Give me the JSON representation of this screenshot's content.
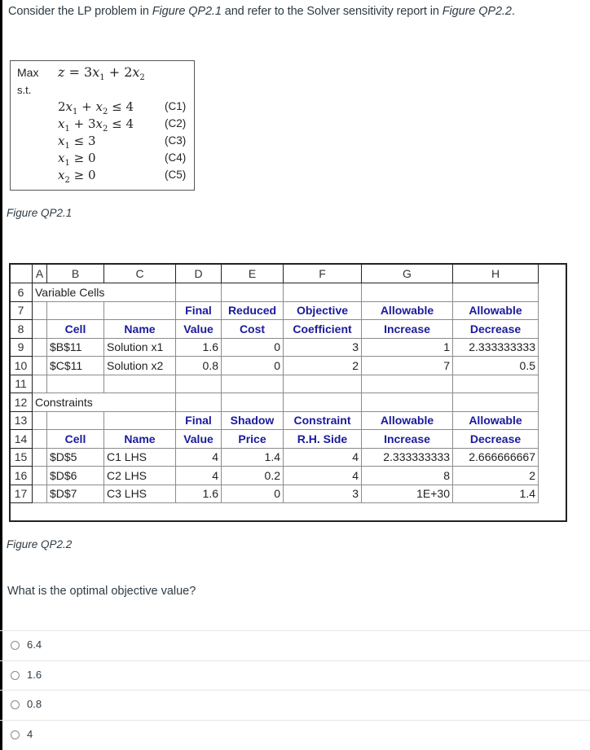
{
  "intro": {
    "prefix": "Consider the LP problem in ",
    "fig1_ref": "Figure QP2.1",
    "middle": " and refer to the Solver sensitivity report in ",
    "fig2_ref": "Figure QP2.2",
    "suffix": "."
  },
  "lp_model": {
    "max_label": "Max",
    "st_label": "s.t.",
    "objective": {
      "lhs": "z",
      "eq": " = 3",
      "v1": "x",
      "s1": "1",
      "plus": " + 2",
      "v2": "x",
      "s2": "2"
    },
    "constraints": [
      {
        "expr_html": "2<i>x</i><sub>1</sub> + <i>x</i><sub>2</sub> ≤ 4",
        "tag": "(C1)"
      },
      {
        "expr_html": "<i>x</i><sub>1</sub> + 3<i>x</i><sub>2</sub> ≤ 4",
        "tag": "(C2)"
      },
      {
        "expr_html": "<i>x</i><sub>1</sub> ≤ 3",
        "tag": "(C3)"
      },
      {
        "expr_html": "<i>x</i><sub>1</sub> ≥ 0",
        "tag": "(C4)"
      },
      {
        "expr_html": "<i>x</i><sub>2</sub> ≥ 0",
        "tag": "(C5)"
      }
    ],
    "caption": "Figure QP2.1"
  },
  "sheet": {
    "columns": [
      "",
      "A",
      "B",
      "C",
      "D",
      "E",
      "F",
      "G",
      "H"
    ],
    "variable_section": {
      "row": "6",
      "title": "Variable Cells",
      "header_rows": [
        {
          "row": "7",
          "cells": [
            "",
            "",
            "Final",
            "Reduced",
            "Objective",
            "Allowable",
            "Allowable"
          ]
        },
        {
          "row": "8",
          "cells": [
            "Cell",
            "Name",
            "Value",
            "Cost",
            "Coefficient",
            "Increase",
            "Decrease"
          ]
        }
      ],
      "rows": [
        {
          "row": "9",
          "cell": "$B$11",
          "name": "Solution x1",
          "final": "1.6",
          "reduced": "0",
          "coef": "3",
          "inc": "1",
          "dec": "2.333333333"
        },
        {
          "row": "10",
          "cell": "$C$11",
          "name": "Solution x2",
          "final": "0.8",
          "reduced": "0",
          "coef": "2",
          "inc": "7",
          "dec": "0.5"
        }
      ],
      "blank_row": "11"
    },
    "constraint_section": {
      "row": "12",
      "title": "Constraints",
      "header_rows": [
        {
          "row": "13",
          "cells": [
            "",
            "",
            "Final",
            "Shadow",
            "Constraint",
            "Allowable",
            "Allowable"
          ]
        },
        {
          "row": "14",
          "cells": [
            "Cell",
            "Name",
            "Value",
            "Price",
            "R.H. Side",
            "Increase",
            "Decrease"
          ]
        }
      ],
      "rows": [
        {
          "row": "15",
          "cell": "$D$5",
          "name": "C1 LHS",
          "final": "4",
          "shadow": "1.4",
          "rhs": "4",
          "inc": "2.333333333",
          "dec": "2.666666667"
        },
        {
          "row": "16",
          "cell": "$D$6",
          "name": "C2 LHS",
          "final": "4",
          "shadow": "0.2",
          "rhs": "4",
          "inc": "8",
          "dec": "2"
        },
        {
          "row": "17",
          "cell": "$D$7",
          "name": "C3 LHS",
          "final": "1.6",
          "shadow": "0",
          "rhs": "3",
          "inc": "1E+30",
          "dec": "1.4"
        }
      ]
    },
    "caption": "Figure QP2.2"
  },
  "question": {
    "text": "What is the optimal objective value?",
    "answers": [
      {
        "label": "6.4",
        "selected": false
      },
      {
        "label": "1.6",
        "selected": false
      },
      {
        "label": "0.8",
        "selected": false
      },
      {
        "label": "4",
        "selected": false
      }
    ]
  }
}
